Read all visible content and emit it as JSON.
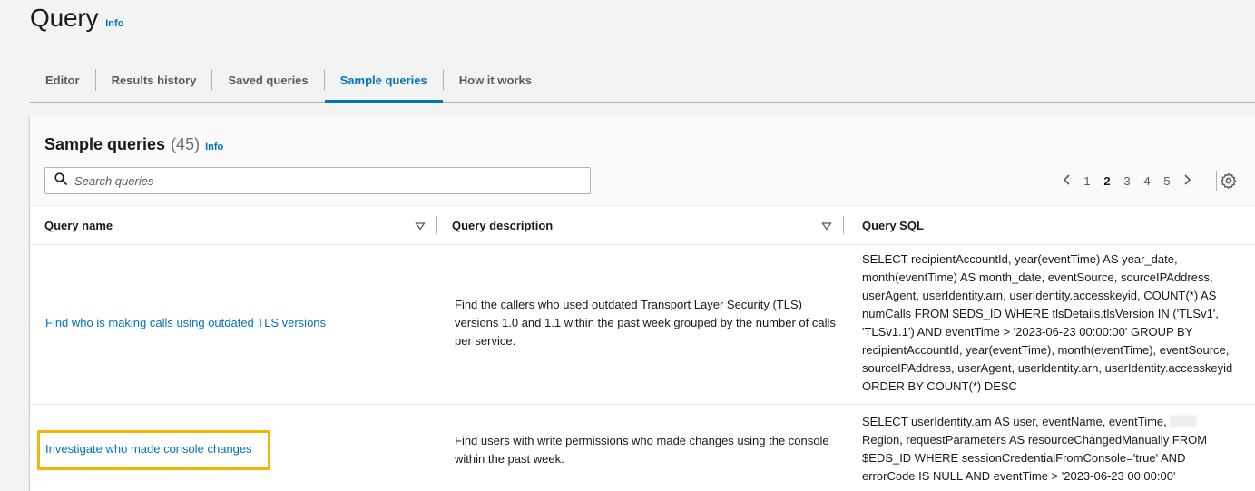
{
  "page": {
    "title": "Query",
    "info_label": "Info"
  },
  "tabs": [
    {
      "label": "Editor",
      "active": false
    },
    {
      "label": "Results history",
      "active": false
    },
    {
      "label": "Saved queries",
      "active": false
    },
    {
      "label": "Sample queries",
      "active": true
    },
    {
      "label": "How it works",
      "active": false
    }
  ],
  "panel": {
    "title": "Sample queries",
    "count": "(45)",
    "info_label": "Info",
    "search_placeholder": "Search queries",
    "pagination": {
      "pages": [
        "1",
        "2",
        "3",
        "4",
        "5"
      ],
      "current_page": "2",
      "prev_icon": "chevron-left-icon",
      "next_icon": "chevron-right-icon"
    },
    "settings_icon": "gear-icon"
  },
  "table": {
    "columns": [
      {
        "label": "Query name",
        "sortable": true
      },
      {
        "label": "Query description",
        "sortable": true
      },
      {
        "label": "Query SQL",
        "sortable": false
      }
    ],
    "rows": [
      {
        "name": "Find who is making calls using outdated TLS versions",
        "description": "Find the callers who used outdated Transport Layer Security (TLS) versions 1.0 and 1.1 within the past week grouped by the number of calls per service.",
        "sql": "SELECT recipientAccountId, year(eventTime) AS year_date, month(eventTime) AS month_date, eventSource, sourceIPAddress, userAgent, userIdentity.arn, userIdentity.accesskeyid, COUNT(*) AS numCalls FROM $EDS_ID WHERE tlsDetails.tlsVersion IN ('TLSv1', 'TLSv1.1') AND eventTime > '2023-06-23 00:00:00' GROUP BY recipientAccountId, year(eventTime), month(eventTime), eventSource, sourceIPAddress, userAgent, userIdentity.arn, userIdentity.accesskeyid ORDER BY COUNT(*) DESC"
      },
      {
        "name": "Investigate who made console changes",
        "description": "Find users with write permissions who made changes using the console within the past week.",
        "sql_part1": "SELECT userIdentity.arn AS user, eventName, eventTime,",
        "sql_part2": "Region, requestParameters AS resourceChangedManually FROM $EDS_ID WHERE sessionCredentialFromConsole='true' AND errorCode IS NULL AND eventTime > '2023-06-23 00:00:00'",
        "highlighted": true
      }
    ]
  },
  "colors": {
    "link": "#0073bb",
    "highlight": "#f5b400",
    "background": "#f2f3f3"
  }
}
